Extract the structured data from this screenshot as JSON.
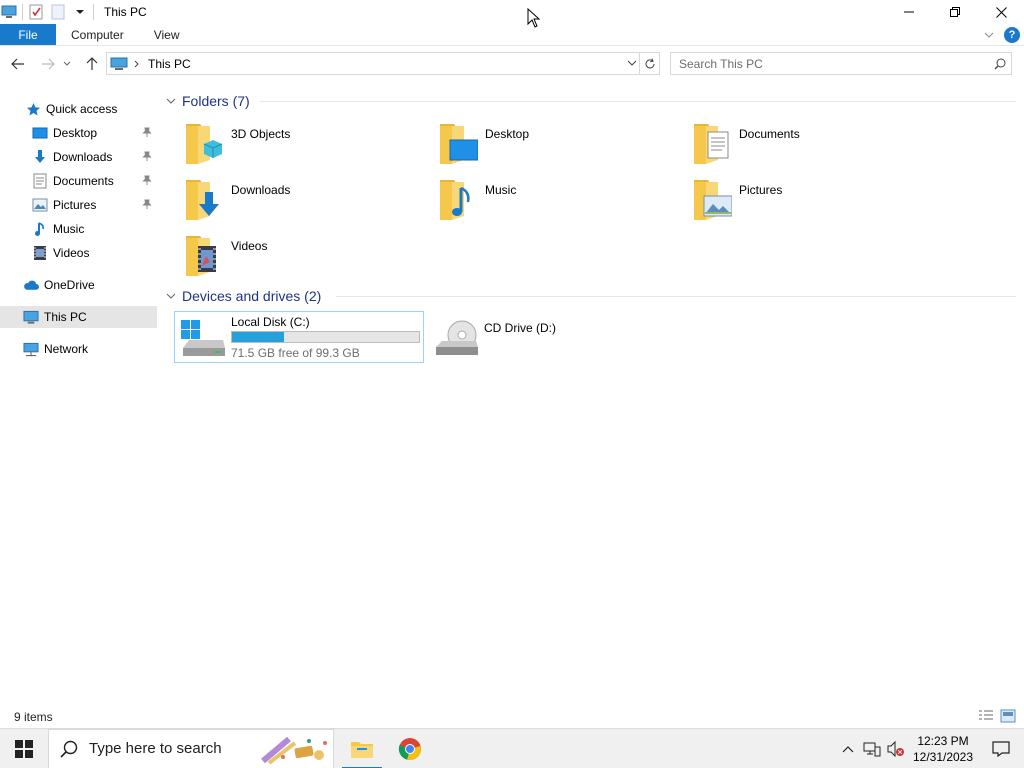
{
  "window": {
    "title": "This PC"
  },
  "ribbon": {
    "tabs": [
      {
        "label": "File"
      },
      {
        "label": "Computer"
      },
      {
        "label": "View"
      }
    ]
  },
  "address": {
    "crumb": "This PC",
    "search_placeholder": "Search This PC"
  },
  "nav": {
    "items": [
      {
        "label": "Quick access",
        "icon": "star-icon"
      },
      {
        "label": "Desktop",
        "icon": "desktop-icon",
        "pinned": true
      },
      {
        "label": "Downloads",
        "icon": "download-icon",
        "pinned": true
      },
      {
        "label": "Documents",
        "icon": "documents-icon",
        "pinned": true
      },
      {
        "label": "Pictures",
        "icon": "pictures-icon",
        "pinned": true
      },
      {
        "label": "Music",
        "icon": "music-icon"
      },
      {
        "label": "Videos",
        "icon": "videos-icon"
      },
      {
        "label": "OneDrive",
        "icon": "cloud-icon"
      },
      {
        "label": "This PC",
        "icon": "computer-icon",
        "selected": true
      },
      {
        "label": "Network",
        "icon": "network-icon"
      }
    ]
  },
  "folders": {
    "header": "Folders (7)",
    "items": [
      {
        "label": "3D Objects",
        "icon": "3d-objects-folder-icon"
      },
      {
        "label": "Desktop",
        "icon": "desktop-folder-icon"
      },
      {
        "label": "Documents",
        "icon": "documents-folder-icon"
      },
      {
        "label": "Downloads",
        "icon": "downloads-folder-icon"
      },
      {
        "label": "Music",
        "icon": "music-folder-icon"
      },
      {
        "label": "Pictures",
        "icon": "pictures-folder-icon"
      },
      {
        "label": "Videos",
        "icon": "videos-folder-icon"
      }
    ]
  },
  "drives": {
    "header": "Devices and drives (2)",
    "items": [
      {
        "label": "Local Disk (C:)",
        "free_text": "71.5 GB free of 99.3 GB",
        "used_fraction": 0.28,
        "icon": "hard-drive-icon"
      },
      {
        "label": "CD Drive (D:)",
        "icon": "cd-drive-icon"
      }
    ]
  },
  "status": {
    "count": "9 items"
  },
  "taskbar": {
    "search_text": "Type here to search",
    "time": "12:23 PM",
    "date": "12/31/2023"
  },
  "colors": {
    "accent": "#1979ca",
    "group_header": "#1e3287",
    "drive_fill": "#26a0da",
    "folder": "#f5c84c"
  }
}
